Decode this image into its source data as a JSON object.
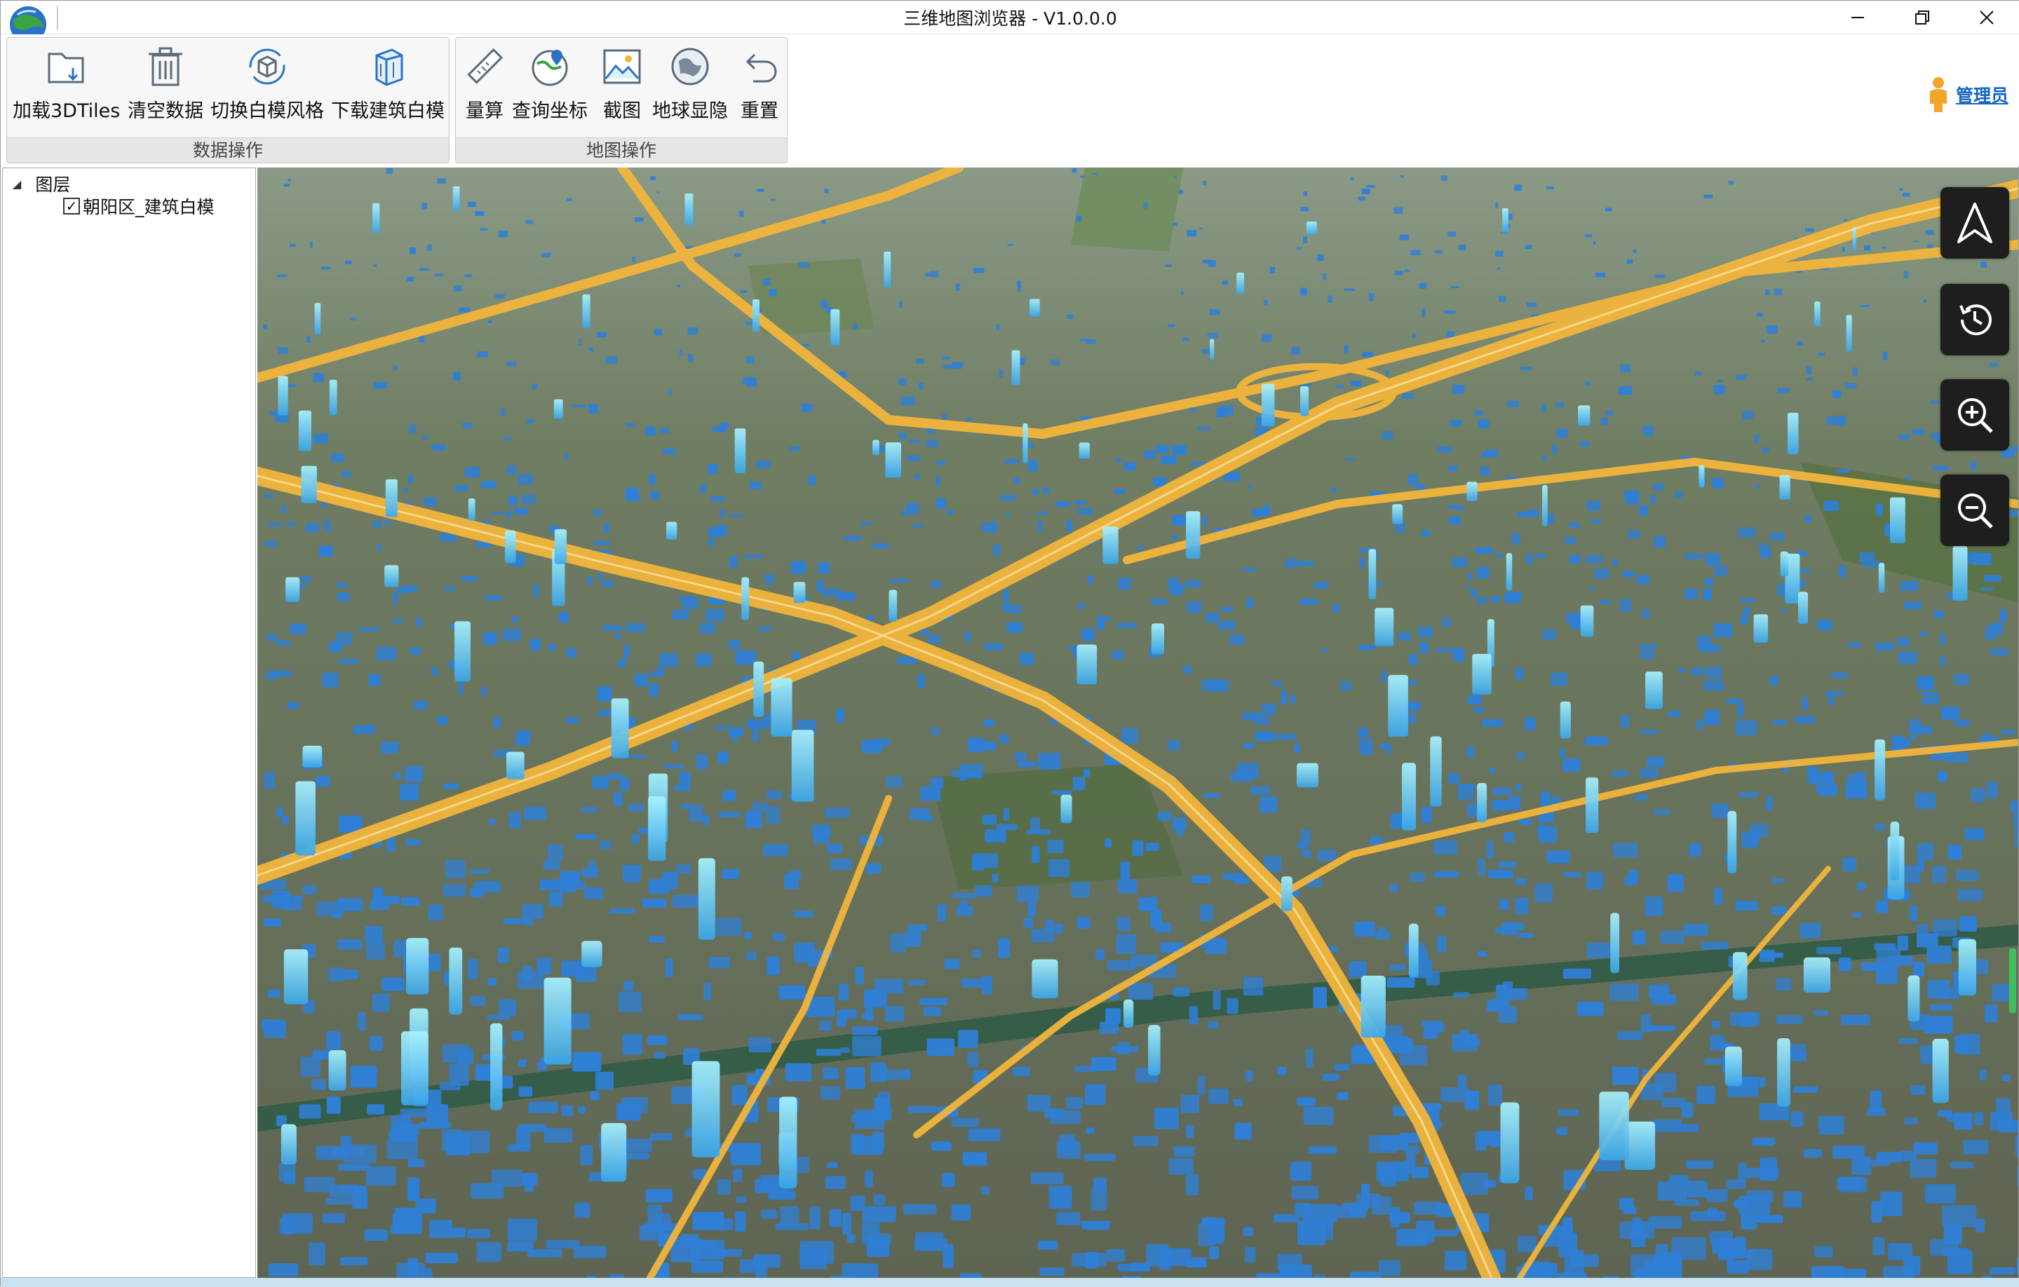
{
  "window": {
    "title": "三维地图浏览器 - V1.0.0.0",
    "app_icon": "globe-icon",
    "controls": [
      "minimize-icon",
      "maximize-icon",
      "close-icon"
    ]
  },
  "ribbon": {
    "groups": [
      {
        "label": "数据操作",
        "buttons": [
          {
            "label": "加载3DTiles",
            "icon": "folder-open-icon"
          },
          {
            "label": "清空数据",
            "icon": "trash-icon"
          },
          {
            "label": "切换白模风格",
            "icon": "cube-refresh-icon"
          },
          {
            "label": "下载建筑白模",
            "icon": "building-download-icon"
          }
        ]
      },
      {
        "label": "地图操作",
        "buttons": [
          {
            "label": "量算",
            "icon": "ruler-icon"
          },
          {
            "label": "查询坐标",
            "icon": "globe-pin-icon"
          },
          {
            "label": "截图",
            "icon": "picture-icon"
          },
          {
            "label": "地球显隐",
            "icon": "globe-toggle-icon"
          },
          {
            "label": "重置",
            "icon": "undo-icon"
          }
        ]
      }
    ]
  },
  "user": {
    "name": "管理员",
    "icon": "user-icon"
  },
  "layer_tree": {
    "root_label": "图层",
    "children": [
      {
        "label": "朝阳区_建筑白模",
        "checked": true
      }
    ]
  },
  "map": {
    "nav_controls": [
      "compass-north-icon",
      "history-icon",
      "zoom-in-icon",
      "zoom-out-icon"
    ]
  },
  "colors": {
    "building": "#2f7fd6",
    "building_highlight": "#7fe6ff",
    "road": "#f2b53c",
    "accent_link": "#1565c0"
  }
}
